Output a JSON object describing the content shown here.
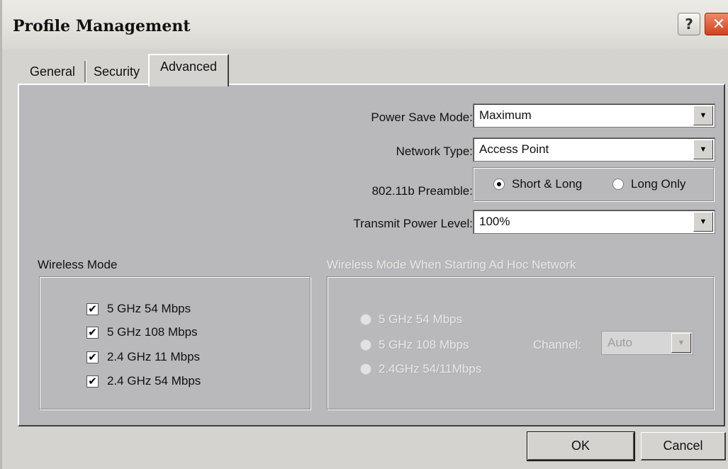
{
  "window": {
    "title": "Profile Management",
    "help_button": "?",
    "close_button": "✕"
  },
  "tabs": [
    {
      "label": "General",
      "selected": false
    },
    {
      "label": "Security",
      "selected": false
    },
    {
      "label": "Advanced",
      "selected": true
    }
  ],
  "settings": {
    "power_save_mode": {
      "label": "Power Save Mode:",
      "value": "Maximum"
    },
    "network_type": {
      "label": "Network Type:",
      "value": "Access Point"
    },
    "preamble": {
      "label": "802.11b Preamble:",
      "options": [
        {
          "label": "Short & Long",
          "selected": true
        },
        {
          "label": "Long Only",
          "selected": false
        }
      ]
    },
    "transmit_power": {
      "label": "Transmit Power Level:",
      "value": "100%"
    }
  },
  "wireless_mode": {
    "title": "Wireless Mode",
    "items": [
      {
        "label": "5 GHz 54 Mbps",
        "checked": true
      },
      {
        "label": "5 GHz 108 Mbps",
        "checked": true
      },
      {
        "label": "2.4 GHz 11 Mbps",
        "checked": true
      },
      {
        "label": "2.4 GHz 54 Mbps",
        "checked": true
      }
    ]
  },
  "adhoc_mode": {
    "title": "Wireless Mode When Starting Ad Hoc Network",
    "enabled": false,
    "options": [
      {
        "label": "5 GHz 54 Mbps"
      },
      {
        "label": "5 GHz 108 Mbps"
      },
      {
        "label": "2.4GHz 54/11Mbps"
      }
    ],
    "channel_label": "Channel:",
    "channel_value": "Auto"
  },
  "buttons": {
    "ok": "OK",
    "cancel": "Cancel"
  },
  "icons": {
    "dropdown_arrow": "▼",
    "checkmark": "✔"
  },
  "colors": {
    "panel_bg": "#b9b9bb",
    "window_bg": "#d4d3d0",
    "close_red": "#d2401c"
  }
}
